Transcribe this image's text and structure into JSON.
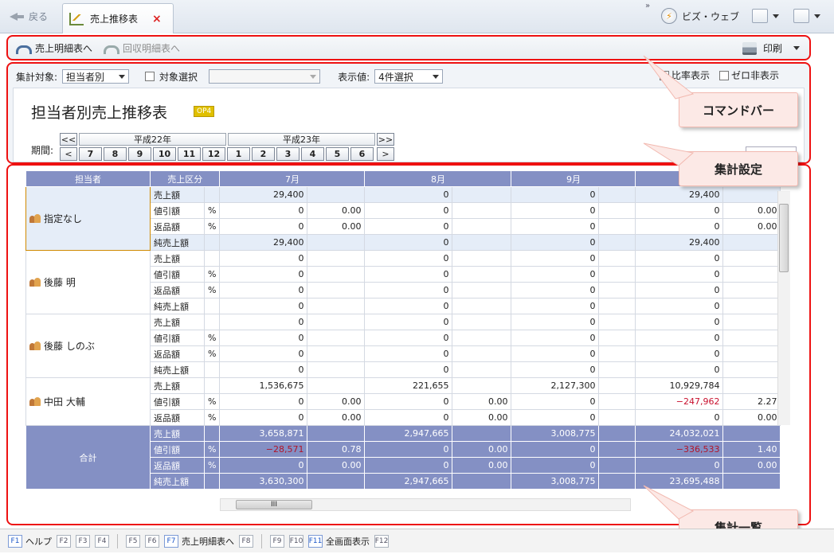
{
  "titlebar": {
    "back_label": "戻る",
    "tab_title": "売上推移表",
    "biz_label": "ビズ・ウェブ",
    "chevrons": "»"
  },
  "commandbar": {
    "items": [
      {
        "label": "売上明細表へ"
      },
      {
        "label": "回収明細表へ"
      }
    ],
    "print_label": "印刷"
  },
  "settings": {
    "target_label": "集計対象:",
    "target_value": "担当者別",
    "select_label": "対象選択",
    "display_label": "表示値:",
    "display_value": "4件選択",
    "ratio_label": "比率表示",
    "zero_label": "ゼロ非表示",
    "page_title": "担当者別売上推移表",
    "op_badge": "OP4",
    "period_label": "期間:",
    "prev_year": "<<",
    "next_year": ">>",
    "prev_month": "<",
    "next_month": ">",
    "years": [
      "平成22年",
      "平成23年"
    ],
    "months_y22": [
      "7",
      "8",
      "9",
      "10",
      "11",
      "12"
    ],
    "months_y23": [
      "1",
      "2",
      "3",
      "4",
      "5",
      "6"
    ]
  },
  "grid": {
    "col_person": "担当者",
    "col_type": "売上区分",
    "months": [
      "7月",
      "8月",
      "9月",
      ""
    ],
    "reps": [
      {
        "name": "指定なし",
        "selected": true,
        "rows": [
          [
            "売上額",
            "",
            "29,400",
            "",
            "0",
            "",
            "0",
            "",
            "29,400",
            ""
          ],
          [
            "値引額",
            "%",
            "0",
            "0.00",
            "0",
            "",
            "0",
            "",
            "0",
            "0.00"
          ],
          [
            "返品額",
            "%",
            "0",
            "0.00",
            "0",
            "",
            "0",
            "",
            "0",
            "0.00"
          ],
          [
            "純売上額",
            "",
            "29,400",
            "",
            "0",
            "",
            "0",
            "",
            "29,400",
            ""
          ]
        ]
      },
      {
        "name": "後藤 明",
        "selected": false,
        "rows": [
          [
            "売上額",
            "",
            "0",
            "",
            "0",
            "",
            "0",
            "",
            "0",
            ""
          ],
          [
            "値引額",
            "%",
            "0",
            "",
            "0",
            "",
            "0",
            "",
            "0",
            ""
          ],
          [
            "返品額",
            "%",
            "0",
            "",
            "0",
            "",
            "0",
            "",
            "0",
            ""
          ],
          [
            "純売上額",
            "",
            "0",
            "",
            "0",
            "",
            "0",
            "",
            "0",
            ""
          ]
        ]
      },
      {
        "name": "後藤 しのぶ",
        "selected": false,
        "rows": [
          [
            "売上額",
            "",
            "0",
            "",
            "0",
            "",
            "0",
            "",
            "0",
            ""
          ],
          [
            "値引額",
            "%",
            "0",
            "",
            "0",
            "",
            "0",
            "",
            "0",
            ""
          ],
          [
            "返品額",
            "%",
            "0",
            "",
            "0",
            "",
            "0",
            "",
            "0",
            ""
          ],
          [
            "純売上額",
            "",
            "0",
            "",
            "0",
            "",
            "0",
            "",
            "0",
            ""
          ]
        ]
      },
      {
        "name": "中田 大輔",
        "selected": false,
        "rows": [
          [
            "売上額",
            "",
            "1,536,675",
            "",
            "221,655",
            "",
            "2,127,300",
            "",
            "10,929,784",
            ""
          ],
          [
            "値引額",
            "%",
            "0",
            "0.00",
            "0",
            "0.00",
            "0",
            "",
            "−247,962",
            "2.27"
          ],
          [
            "返品額",
            "%",
            "0",
            "0.00",
            "0",
            "0.00",
            "0",
            "",
            "0",
            "0.00"
          ]
        ]
      }
    ],
    "total_label": "合計",
    "total_rows": [
      [
        "売上額",
        "",
        "3,658,871",
        "",
        "2,947,665",
        "",
        "3,008,775",
        "",
        "24,032,021",
        ""
      ],
      [
        "値引額",
        "%",
        "−28,571",
        "0.78",
        "0",
        "0.00",
        "0",
        "",
        "−336,533",
        "1.40"
      ],
      [
        "返品額",
        "%",
        "0",
        "0.00",
        "0",
        "0.00",
        "0",
        "",
        "0",
        "0.00"
      ],
      [
        "純売上額",
        "",
        "3,630,300",
        "",
        "2,947,665",
        "",
        "3,008,775",
        "",
        "23,695,488",
        ""
      ]
    ],
    "hscroll_grip": "III"
  },
  "callouts": {
    "command": "コマンドバー",
    "settings": "集計設定",
    "list": "集計一覧"
  },
  "fkeys": [
    {
      "key": "F1",
      "label": "ヘルプ",
      "on": true
    },
    {
      "key": "F2",
      "label": "",
      "on": false
    },
    {
      "key": "F3",
      "label": "",
      "on": false
    },
    {
      "key": "F4",
      "label": "",
      "on": false
    },
    {
      "key": "F5",
      "label": "",
      "on": false
    },
    {
      "key": "F6",
      "label": "",
      "on": false
    },
    {
      "key": "F7",
      "label": "売上明細表へ",
      "on": true
    },
    {
      "key": "F8",
      "label": "",
      "on": false
    },
    {
      "key": "F9",
      "label": "",
      "on": false
    },
    {
      "key": "F10",
      "label": "",
      "on": false
    },
    {
      "key": "F11",
      "label": "全画面表示",
      "on": true
    },
    {
      "key": "F12",
      "label": "",
      "on": false
    }
  ]
}
